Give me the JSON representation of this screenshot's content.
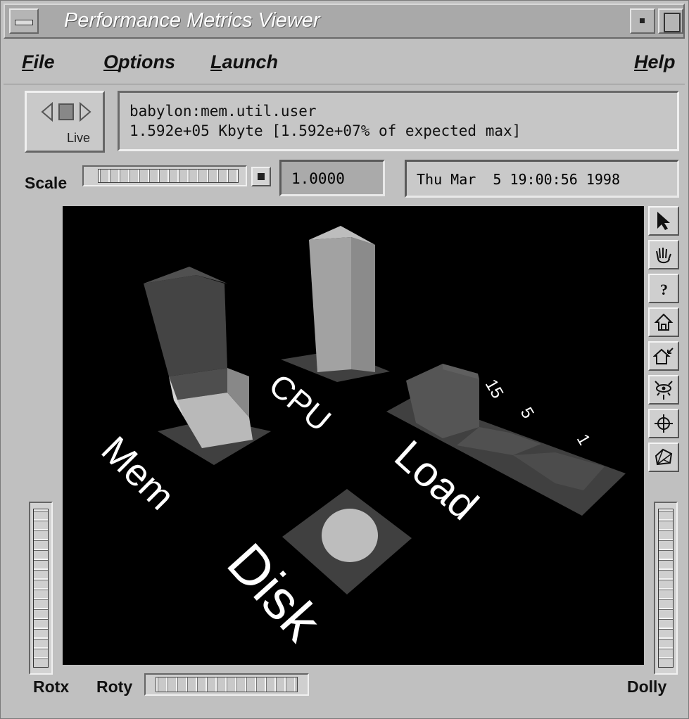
{
  "window": {
    "title": "Performance Metrics Viewer"
  },
  "menu": {
    "file": {
      "mnemonic": "F",
      "rest": "ile"
    },
    "options": {
      "mnemonic": "O",
      "rest": "ptions"
    },
    "launch": {
      "mnemonic": "L",
      "rest": "aunch"
    },
    "help": {
      "mnemonic": "H",
      "rest": "elp"
    }
  },
  "live_button": {
    "label": "Live"
  },
  "info": {
    "metric": "babylon:mem.util.user",
    "value": "1.592e+05 Kbyte [1.592e+07% of expected max]"
  },
  "scale": {
    "label": "Scale",
    "value": "1.0000"
  },
  "timestamp": "Thu Mar  5 19:00:56 1998",
  "scene": {
    "labels": {
      "mem": "Mem",
      "cpu": "CPU",
      "load": "Load",
      "disk": "Disk"
    },
    "load_ticks": [
      "15",
      "5",
      "1"
    ]
  },
  "thumbwheels": {
    "rotx": "Rotx",
    "roty": "Roty",
    "dolly": "Dolly"
  },
  "tools": [
    "pick-icon",
    "view-hand-icon",
    "help-icon",
    "home-icon",
    "set-home-icon",
    "view-all-icon",
    "seek-icon",
    "projection-icon"
  ]
}
